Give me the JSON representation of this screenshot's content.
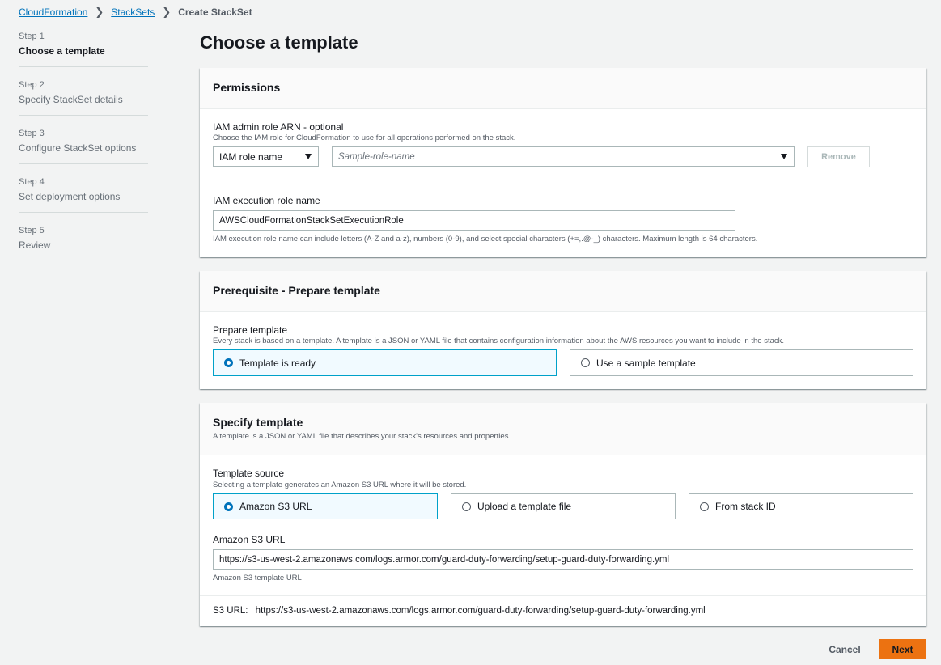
{
  "breadcrumb": {
    "items": [
      "CloudFormation",
      "StackSets"
    ],
    "current": "Create StackSet"
  },
  "steps": [
    {
      "num": "Step 1",
      "title": "Choose a template"
    },
    {
      "num": "Step 2",
      "title": "Specify StackSet details"
    },
    {
      "num": "Step 3",
      "title": "Configure StackSet options"
    },
    {
      "num": "Step 4",
      "title": "Set deployment options"
    },
    {
      "num": "Step 5",
      "title": "Review"
    }
  ],
  "page_title": "Choose a template",
  "permissions": {
    "header": "Permissions",
    "admin_label": "IAM admin role ARN - optional",
    "admin_desc": "Choose the IAM role for CloudFormation to use for all operations performed on the stack.",
    "role_type_value": "IAM role name",
    "role_name_placeholder": "Sample-role-name",
    "remove_label": "Remove",
    "exec_label": "IAM execution role name",
    "exec_value": "AWSCloudFormationStackSetExecutionRole",
    "exec_desc": "IAM execution role name can include letters (A-Z and a-z), numbers (0-9), and select special characters (+=,.@-_) characters. Maximum length is 64 characters."
  },
  "prerequisite": {
    "header": "Prerequisite - Prepare template",
    "label": "Prepare template",
    "desc": "Every stack is based on a template. A template is a JSON or YAML file that contains configuration information about the AWS resources you want to include in the stack.",
    "option_ready": "Template is ready",
    "option_sample": "Use a sample template"
  },
  "specify": {
    "header": "Specify template",
    "header_desc": "A template is a JSON or YAML file that describes your stack's resources and properties.",
    "source_label": "Template source",
    "source_desc": "Selecting a template generates an Amazon S3 URL where it will be stored.",
    "option_s3": "Amazon S3 URL",
    "option_upload": "Upload a template file",
    "option_stackid": "From stack ID",
    "s3_label": "Amazon S3 URL",
    "s3_value": "https://s3-us-west-2.amazonaws.com/logs.armor.com/guard-duty-forwarding/setup-guard-duty-forwarding.yml",
    "s3_hint": "Amazon S3 template URL",
    "s3_url_prefix": "S3 URL:",
    "s3_url_value": "https://s3-us-west-2.amazonaws.com/logs.armor.com/guard-duty-forwarding/setup-guard-duty-forwarding.yml"
  },
  "footer": {
    "cancel": "Cancel",
    "next": "Next"
  },
  "colors": {
    "link": "#0073bb",
    "primary_button": "#ec7211",
    "selected_tile": "#00a1c9"
  }
}
